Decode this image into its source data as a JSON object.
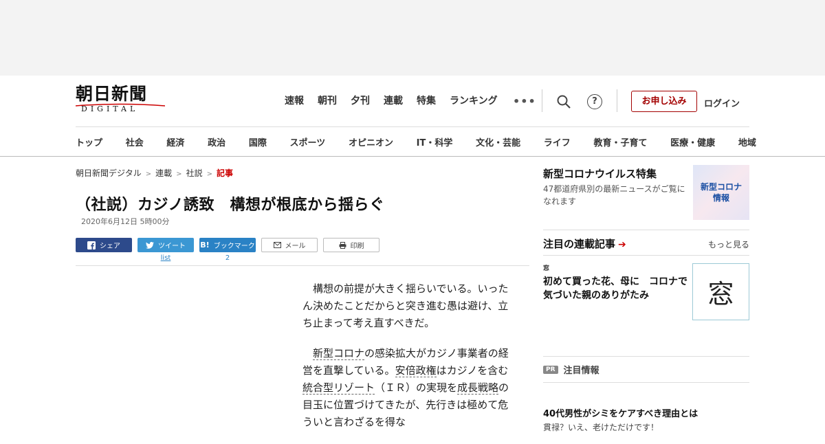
{
  "logo": {
    "kanji": "朝日新聞",
    "sub": "DIGITAL"
  },
  "topnav": [
    "速報",
    "朝刊",
    "夕刊",
    "連載",
    "特集",
    "ランキング"
  ],
  "more_dots": "•••",
  "help_label": "?",
  "apply_label": "お申し込み",
  "login_label": "ログイン",
  "category_nav": [
    "トップ",
    "社会",
    "経済",
    "政治",
    "国際",
    "スポーツ",
    "オピニオン",
    "IT・科学",
    "文化・芸能",
    "ライフ",
    "教育・子育て",
    "医療・健康",
    "地域"
  ],
  "breadcrumb": {
    "items": [
      "朝日新聞デジタル",
      "連載",
      "社説"
    ],
    "current": "記事",
    "sep": ">"
  },
  "article": {
    "title": "（社説）カジノ誘致　構想が根底から揺らぐ",
    "date": "2020年6月12日 5時00分"
  },
  "share": {
    "facebook": "シェア",
    "twitter": "ツイート",
    "twitter_count": "list",
    "hatena_icon": "B!",
    "hatena": "ブックマーク",
    "hatena_count": "2",
    "mail": "メール",
    "print": "印刷"
  },
  "body": {
    "p1": "構想の前提が大きく揺らいでいる。いったん決めたことだからと突き進む愚は避け、立ち止まって考え直すべきだ。",
    "p2": {
      "kw1": "新型コロナ",
      "t1": "の感染拡大がカジノ事業者の経営を直撃している。",
      "kw2": "安倍政権",
      "t2": "はカジノを含む",
      "kw3": "統合型リゾート",
      "t3": "（ＩＲ）の実現を",
      "kw4": "成長戦略",
      "t4": "の目玉に位置づけてきたが、先行きは極めて危ういと言わざるを得な"
    }
  },
  "sidebar": {
    "corona": {
      "title": "新型コロナウイルス特集",
      "desc": "47都道府県別の最新ニュースがご覧になれます",
      "thumb_line1": "新型コロナ",
      "thumb_line2": "情報"
    },
    "rensai": {
      "title": "注目の連載記事",
      "more": "もっと見る",
      "series_label": "窓",
      "headline": "初めて買った花、母に　コロナで気づいた親のありがたみ",
      "thumb_char": "窓"
    },
    "pr": {
      "badge": "PR",
      "label": "注目情報"
    },
    "ad": {
      "headline": "40代男性がシミをケアすべき理由とは",
      "sub": "貫禄？いえ、老けただけです！"
    }
  },
  "colors": {
    "accent_red": "#a30000",
    "facebook": "#2d4a8b",
    "twitter": "#3b97d3",
    "hatena": "#2a82c5"
  }
}
